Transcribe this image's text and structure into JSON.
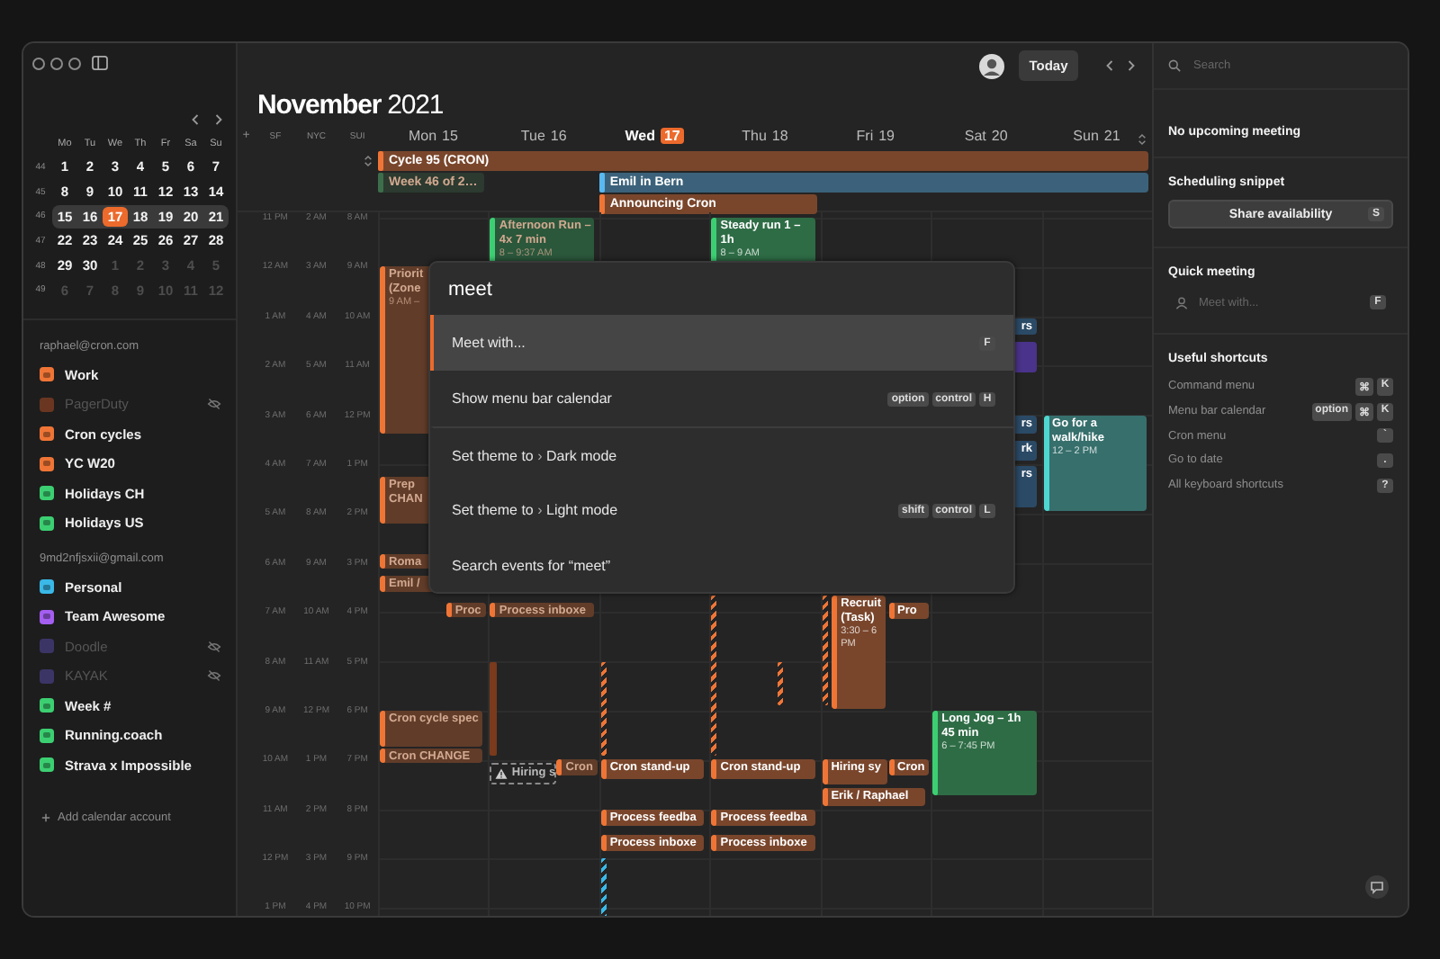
{
  "sidebar": {
    "mini_calendar": {
      "weekdays": [
        "Mo",
        "Tu",
        "We",
        "Th",
        "Fr",
        "Sa",
        "Su"
      ],
      "weeks": [
        {
          "number": "44",
          "current": false,
          "days": [
            {
              "day": "1",
              "outside": false,
              "selected": false
            },
            {
              "day": "2",
              "outside": false,
              "selected": false
            },
            {
              "day": "3",
              "outside": false,
              "selected": false
            },
            {
              "day": "4",
              "outside": false,
              "selected": false
            },
            {
              "day": "5",
              "outside": false,
              "selected": false
            },
            {
              "day": "6",
              "outside": false,
              "selected": false
            },
            {
              "day": "7",
              "outside": false,
              "selected": false
            }
          ]
        },
        {
          "number": "45",
          "current": false,
          "days": [
            {
              "day": "8",
              "outside": false,
              "selected": false
            },
            {
              "day": "9",
              "outside": false,
              "selected": false
            },
            {
              "day": "10",
              "outside": false,
              "selected": false
            },
            {
              "day": "11",
              "outside": false,
              "selected": false
            },
            {
              "day": "12",
              "outside": false,
              "selected": false
            },
            {
              "day": "13",
              "outside": false,
              "selected": false
            },
            {
              "day": "14",
              "outside": false,
              "selected": false
            }
          ]
        },
        {
          "number": "46",
          "current": true,
          "days": [
            {
              "day": "15",
              "outside": false,
              "selected": false
            },
            {
              "day": "16",
              "outside": false,
              "selected": false
            },
            {
              "day": "17",
              "outside": false,
              "selected": true
            },
            {
              "day": "18",
              "outside": false,
              "selected": false
            },
            {
              "day": "19",
              "outside": false,
              "selected": false
            },
            {
              "day": "20",
              "outside": false,
              "selected": false
            },
            {
              "day": "21",
              "outside": false,
              "selected": false
            }
          ]
        },
        {
          "number": "47",
          "current": false,
          "days": [
            {
              "day": "22",
              "outside": false,
              "selected": false
            },
            {
              "day": "23",
              "outside": false,
              "selected": false
            },
            {
              "day": "24",
              "outside": false,
              "selected": false
            },
            {
              "day": "25",
              "outside": false,
              "selected": false
            },
            {
              "day": "26",
              "outside": false,
              "selected": false
            },
            {
              "day": "27",
              "outside": false,
              "selected": false
            },
            {
              "day": "28",
              "outside": false,
              "selected": false
            }
          ]
        },
        {
          "number": "48",
          "current": false,
          "days": [
            {
              "day": "29",
              "outside": false,
              "selected": false
            },
            {
              "day": "30",
              "outside": false,
              "selected": false
            },
            {
              "day": "1",
              "outside": true,
              "selected": false
            },
            {
              "day": "2",
              "outside": true,
              "selected": false
            },
            {
              "day": "3",
              "outside": true,
              "selected": false
            },
            {
              "day": "4",
              "outside": true,
              "selected": false
            },
            {
              "day": "5",
              "outside": true,
              "selected": false
            }
          ]
        },
        {
          "number": "49",
          "current": false,
          "days": [
            {
              "day": "6",
              "outside": true,
              "selected": false
            },
            {
              "day": "7",
              "outside": true,
              "selected": false
            },
            {
              "day": "8",
              "outside": true,
              "selected": false
            },
            {
              "day": "9",
              "outside": true,
              "selected": false
            },
            {
              "day": "10",
              "outside": true,
              "selected": false
            },
            {
              "day": "11",
              "outside": true,
              "selected": false
            },
            {
              "day": "12",
              "outside": true,
              "selected": false
            }
          ]
        }
      ]
    },
    "accounts": [
      {
        "email": "raphael@cron.com",
        "calendars": [
          {
            "name": "Work",
            "color": "#ef7536",
            "hidden": false
          },
          {
            "name": "PagerDuty",
            "color": "#6a3621",
            "hidden": true
          },
          {
            "name": "Cron cycles",
            "color": "#ef7536",
            "hidden": false
          },
          {
            "name": "YC W20",
            "color": "#ef7536",
            "hidden": false
          },
          {
            "name": "Holidays CH",
            "color": "#3ccf72",
            "hidden": false
          },
          {
            "name": "Holidays US",
            "color": "#3ccf72",
            "hidden": false
          }
        ]
      },
      {
        "email": "9md2nfjsxii@gmail.com",
        "calendars": [
          {
            "name": "Personal",
            "color": "#3ab8e8",
            "hidden": false
          },
          {
            "name": "Team Awesome",
            "color": "#a45ef0",
            "hidden": false
          },
          {
            "name": "Doodle",
            "color": "#3b3566",
            "hidden": true
          },
          {
            "name": "KAYAK",
            "color": "#3b3566",
            "hidden": true
          },
          {
            "name": "Week #",
            "color": "#3ccf72",
            "hidden": false
          },
          {
            "name": "Running.coach",
            "color": "#3ccf72",
            "hidden": false
          },
          {
            "name": "Strava x Impossible",
            "color": "#3ccf72",
            "hidden": false
          }
        ]
      }
    ],
    "add_account": "Add calendar account"
  },
  "calendar": {
    "title": "**November** 2021",
    "today_button": "Today",
    "timezone_add": "+",
    "timezones": [
      "SF",
      "NYC",
      "SUI"
    ],
    "all_day": [
      {
        "title": "Cycle 95 (CRON)",
        "color": "#ef7536",
        "past": false
      },
      {
        "title": "Week 46 of 2…",
        "color": "#3d6e4b",
        "past": true
      },
      {
        "title": "Emil in Bern",
        "color": "#5ab8f0",
        "past": false
      },
      {
        "title": "Announcing Cron",
        "color": "#ef7536",
        "past": false
      }
    ],
    "hours": [
      [
        "11 PM",
        "2 AM",
        "8 AM"
      ],
      [
        "12 AM",
        "3 AM",
        "9 AM"
      ],
      [
        "1 AM",
        "4 AM",
        "10 AM"
      ],
      [
        "2 AM",
        "5 AM",
        "11 AM"
      ],
      [
        "3 AM",
        "6 AM",
        "12 PM"
      ],
      [
        "4 AM",
        "7 AM",
        "1 PM"
      ],
      [
        "5 AM",
        "8 AM",
        "2 PM"
      ],
      [
        "6 AM",
        "9 AM",
        "3 PM"
      ],
      [
        "7 AM",
        "10 AM",
        "4 PM"
      ],
      [
        "8 AM",
        "11 AM",
        "5 PM"
      ],
      [
        "9 AM",
        "12 PM",
        "6 PM"
      ],
      [
        "10 AM",
        "1 PM",
        "7 PM"
      ],
      [
        "11 AM",
        "2 PM",
        "8 PM"
      ],
      [
        "12 PM",
        "3 PM",
        "9 PM"
      ],
      [
        "1 PM",
        "4 PM",
        "10 PM"
      ]
    ],
    "days": [
      {
        "name": "Mon",
        "date": "15",
        "today": false,
        "events": [
          {
            "kind": "block",
            "title": "Priorit (Zone",
            "time": "9 AM –",
            "color": "#ef7536",
            "past": true
          },
          {
            "kind": "block",
            "title": "Prep CHAN",
            "color": "#ef7536",
            "past": true
          },
          {
            "kind": "block",
            "title": "Roma",
            "color": "#ef7536",
            "past": true
          },
          {
            "kind": "block",
            "title": "Emil /",
            "color": "#ef7536",
            "past": true
          },
          {
            "kind": "block",
            "title": "Proc",
            "color": "#ef7536",
            "past": true
          },
          {
            "kind": "block",
            "title": "Cron cycle spec",
            "color": "#ef7536",
            "past": true
          },
          {
            "kind": "block",
            "title": "Cron CHANGE",
            "color": "#ef7536",
            "past": true
          }
        ]
      },
      {
        "name": "Tue",
        "date": "16",
        "today": false,
        "events": [
          {
            "kind": "block",
            "title": "Afternoon Run – 4x 7 min",
            "time": "8 – 9:37 AM",
            "color": "#3ccf72",
            "past": true
          },
          {
            "kind": "block",
            "title": "Process inboxe",
            "color": "#ef7536",
            "past": true
          },
          {
            "kind": "bar",
            "color": "#7a3a1c"
          },
          {
            "kind": "pending",
            "title": "Hiring s",
            "color": "#8a8a8a"
          },
          {
            "kind": "block",
            "title": "Cron",
            "color": "#ef7536",
            "past": true
          }
        ]
      },
      {
        "name": "Wed",
        "date": "17",
        "today": true,
        "events": [
          {
            "kind": "tentative",
            "color": "#ef7536"
          },
          {
            "kind": "block",
            "title": "Cron stand-up",
            "color": "#ef7536",
            "past": false
          },
          {
            "kind": "block",
            "title": "Process feedba",
            "color": "#ef7536",
            "past": false
          },
          {
            "kind": "block",
            "title": "Process inboxe",
            "color": "#ef7536",
            "past": false
          },
          {
            "kind": "tentative",
            "color": "#3ab8e8"
          }
        ]
      },
      {
        "name": "Thu",
        "date": "18",
        "today": false,
        "events": [
          {
            "kind": "block",
            "title": "Steady run 1 – 1h",
            "time": "8 – 9 AM",
            "color": "#3ccf72",
            "past": false
          },
          {
            "kind": "tentative",
            "color": "#ef7536"
          },
          {
            "kind": "tentative",
            "color": "#ef7536"
          },
          {
            "kind": "block",
            "title": "Cron stand-up",
            "color": "#ef7536",
            "past": false
          },
          {
            "kind": "block",
            "title": "Process feedba",
            "color": "#ef7536",
            "past": false
          },
          {
            "kind": "block",
            "title": "Process inboxe",
            "color": "#ef7536",
            "past": false
          }
        ]
      },
      {
        "name": "Fri",
        "date": "19",
        "today": false,
        "events": [
          {
            "kind": "tentative",
            "color": "#ef7536"
          },
          {
            "kind": "block",
            "title": "Recruit (Task)",
            "time": "3:30 – 6 PM",
            "color": "#ef7536",
            "past": false
          },
          {
            "kind": "block",
            "title": "Pro",
            "color": "#ef7536",
            "past": false
          },
          {
            "kind": "block",
            "title": "Hiring sy",
            "color": "#ef7536",
            "past": false
          },
          {
            "kind": "block",
            "title": "Cron",
            "color": "#ef7536",
            "past": false
          },
          {
            "kind": "block",
            "title": "Erik / Raphael",
            "color": "#ef7536",
            "past": false
          }
        ]
      },
      {
        "name": "Sat",
        "date": "20",
        "today": false,
        "events": [
          {
            "kind": "peek",
            "title": "rs",
            "color": "#2b4a66"
          },
          {
            "kind": "peek",
            "color": "#4a338a"
          },
          {
            "kind": "peek",
            "title": "rs",
            "color": "#2b4a66"
          },
          {
            "kind": "peek",
            "title": "rk",
            "color": "#2b4a66"
          },
          {
            "kind": "peek",
            "title": "rs",
            "color": "#2b4a66"
          },
          {
            "kind": "block",
            "title": "Long Jog – 1h 45 min",
            "time": "6 – 7:45 PM",
            "color": "#3ccf72",
            "past": false
          }
        ]
      },
      {
        "name": "Sun",
        "date": "21",
        "today": false,
        "events": [
          {
            "kind": "block",
            "title": "Go for a walk/hike",
            "time": "12 – 2 PM",
            "color": "#4fd6d0",
            "past": false
          }
        ]
      }
    ]
  },
  "command_menu": {
    "query": "meet",
    "items": [
      {
        "label": "Meet with...",
        "keys": [
          "F"
        ],
        "selected": true,
        "separated": false
      },
      {
        "label": "Show menu bar calendar",
        "keys": [
          "option",
          "control",
          "H"
        ],
        "selected": false,
        "separated": false
      },
      {
        "prefix": "Set theme to",
        "separator": "›",
        "label": "Dark mode",
        "selected": false,
        "separated": true
      },
      {
        "prefix": "Set theme to",
        "separator": "›",
        "label": "Light mode",
        "keys": [
          "shift",
          "control",
          "L"
        ],
        "selected": false,
        "separated": false
      },
      {
        "label": "Search events for “meet”",
        "selected": false,
        "separated": false
      }
    ]
  },
  "right_panel": {
    "search_placeholder": "Search",
    "upcoming": "No upcoming meeting",
    "scheduling": {
      "title": "Scheduling snippet",
      "button": "Share availability",
      "key": "S"
    },
    "quick_meeting": {
      "title": "Quick meeting",
      "placeholder": "Meet with...",
      "key": "F"
    },
    "shortcuts": {
      "title": "Useful shortcuts",
      "items": [
        {
          "label": "Command menu",
          "keys": [
            "⌘",
            "K"
          ]
        },
        {
          "label": "Menu bar calendar",
          "keys": [
            "option",
            "⌘",
            "K"
          ]
        },
        {
          "label": "Cron menu",
          "keys": [
            "`"
          ]
        },
        {
          "label": "Go to date",
          "keys": [
            "."
          ]
        },
        {
          "label": "All keyboard shortcuts",
          "keys": [
            "?"
          ]
        }
      ]
    }
  }
}
